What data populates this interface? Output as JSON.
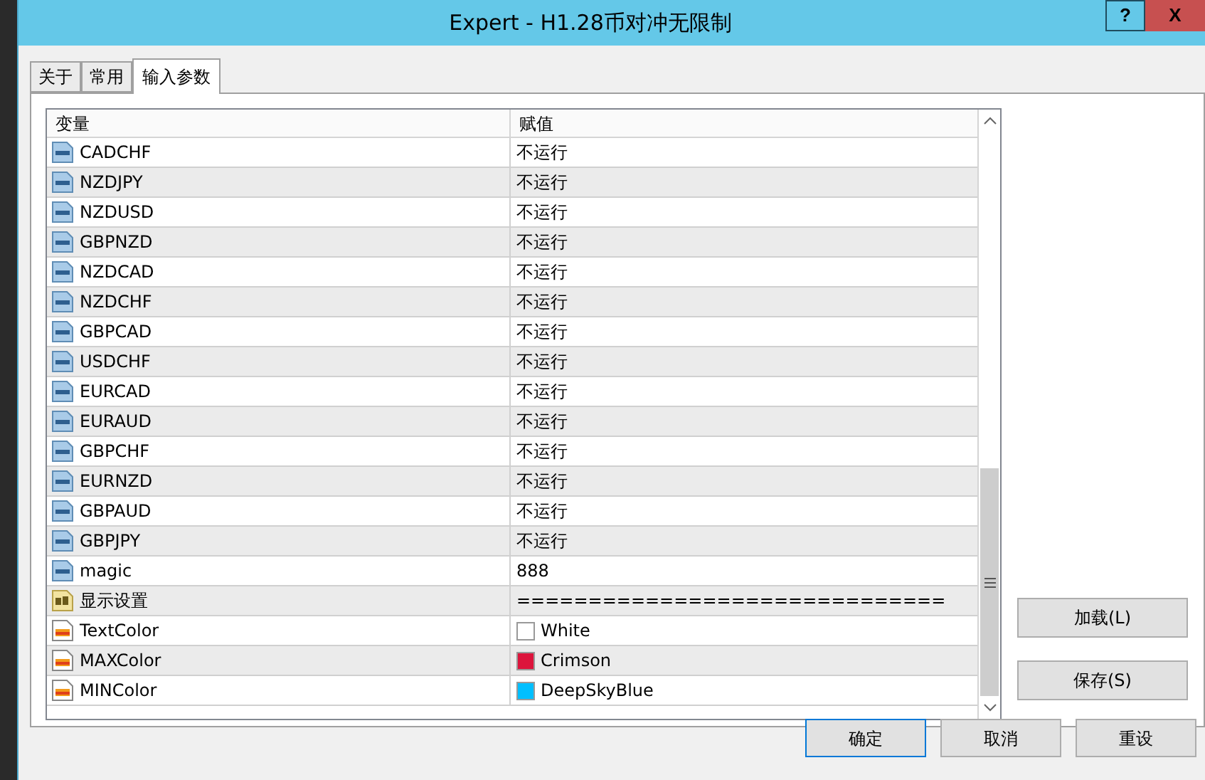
{
  "window": {
    "title": "Expert - H1.28币对冲无限制",
    "help": "?",
    "close": "X"
  },
  "tabs": [
    {
      "label": "关于",
      "selected": false
    },
    {
      "label": "常用",
      "selected": false
    },
    {
      "label": "输入参数",
      "selected": true
    }
  ],
  "table": {
    "columns": [
      "变量",
      "赋值"
    ],
    "rows": [
      {
        "kind": "int",
        "name": "CADCHF",
        "value": "不运行"
      },
      {
        "kind": "int",
        "name": "NZDJPY",
        "value": "不运行"
      },
      {
        "kind": "int",
        "name": "NZDUSD",
        "value": "不运行"
      },
      {
        "kind": "int",
        "name": "GBPNZD",
        "value": "不运行"
      },
      {
        "kind": "int",
        "name": "NZDCAD",
        "value": "不运行"
      },
      {
        "kind": "int",
        "name": "NZDCHF",
        "value": "不运行"
      },
      {
        "kind": "int",
        "name": "GBPCAD",
        "value": "不运行"
      },
      {
        "kind": "int",
        "name": "USDCHF",
        "value": "不运行"
      },
      {
        "kind": "int",
        "name": "EURCAD",
        "value": "不运行"
      },
      {
        "kind": "int",
        "name": "EURAUD",
        "value": "不运行"
      },
      {
        "kind": "int",
        "name": "GBPCHF",
        "value": "不运行"
      },
      {
        "kind": "int",
        "name": "EURNZD",
        "value": "不运行"
      },
      {
        "kind": "int",
        "name": "GBPAUD",
        "value": "不运行"
      },
      {
        "kind": "int",
        "name": "GBPJPY",
        "value": "不运行"
      },
      {
        "kind": "int",
        "name": "magic",
        "value": "888"
      },
      {
        "kind": "string",
        "name": "显示设置",
        "value": "=============================="
      },
      {
        "kind": "color",
        "name": "TextColor",
        "value": "White",
        "color": "#ffffff"
      },
      {
        "kind": "color",
        "name": "MAXColor",
        "value": "Crimson",
        "color": "#dc143c"
      },
      {
        "kind": "color",
        "name": "MINColor",
        "value": "DeepSkyBlue",
        "color": "#00bfff"
      }
    ]
  },
  "side_buttons": [
    "加载(L)",
    "保存(S)"
  ],
  "bottom_buttons": [
    "确定",
    "取消",
    "重设"
  ]
}
